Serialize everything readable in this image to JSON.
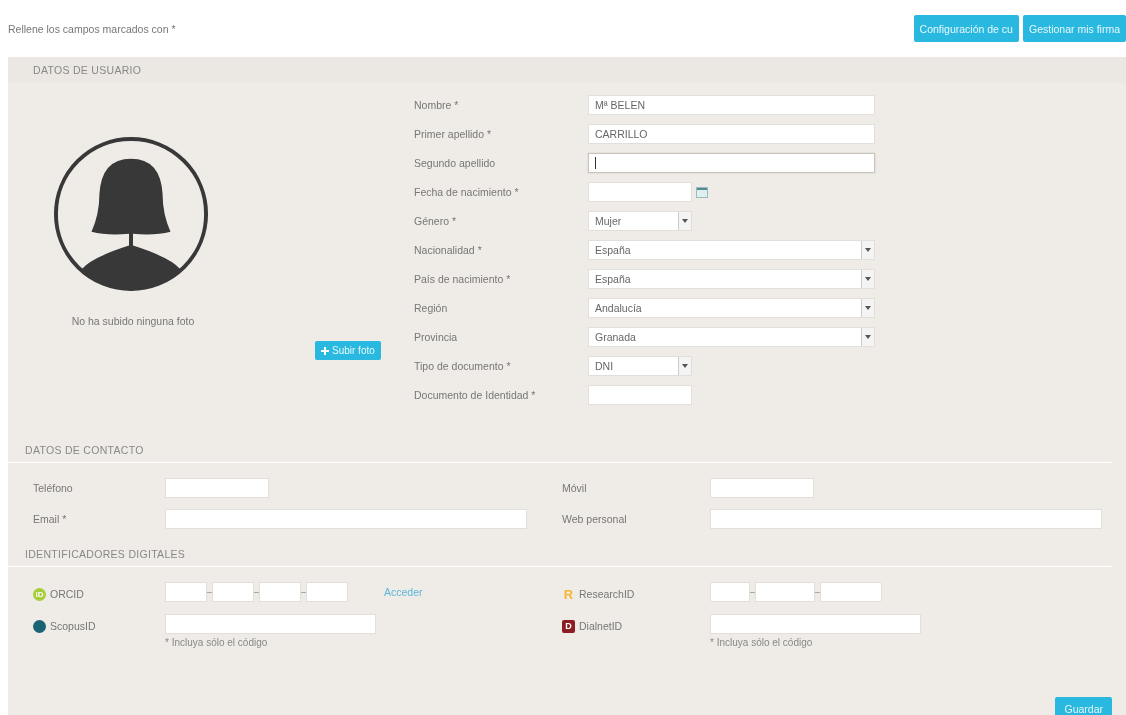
{
  "top": {
    "instruction": "Rellene los campos marcados con *",
    "buttons": [
      "Configuración de cu",
      "Gestionar mis firma"
    ]
  },
  "user": {
    "title": "DATOS DE USUARIO",
    "photo_caption": "No ha subido ninguna foto",
    "upload_button": "Subir foto",
    "fields": [
      {
        "label": "Nombre *",
        "kind": "text",
        "value": "Mª BELEN",
        "focused": false
      },
      {
        "label": "Primer apellido *",
        "kind": "text",
        "value": "CARRILLO",
        "focused": false
      },
      {
        "label": "Segundo apellido",
        "kind": "text",
        "focused": true
      },
      {
        "label": "Fecha de nacimiento *",
        "kind": "date",
        "focused": false
      },
      {
        "label": "Género *",
        "kind": "short_select",
        "value": "Mujer",
        "focused": false
      },
      {
        "label": "Nacionalidad *",
        "kind": "select",
        "value": "España",
        "focused": false
      },
      {
        "label": "País de nacimiento *",
        "kind": "select",
        "value": "España",
        "focused": false
      },
      {
        "label": "Región",
        "kind": "select",
        "value": "Andalucía",
        "focused": false
      },
      {
        "label": "Provincia",
        "kind": "select",
        "value": "Granada",
        "focused": false
      },
      {
        "label": "Tipo de documento *",
        "kind": "short_select",
        "value": "DNI",
        "focused": false
      },
      {
        "label": "Documento de Identidad *",
        "kind": "short_text",
        "focused": false
      }
    ]
  },
  "contact": {
    "title": "DATOS DE CONTACTO",
    "fields": [
      {
        "label": "Teléfono",
        "kind": "short_text"
      },
      {
        "label": "Móvil",
        "kind": "short_text"
      },
      {
        "label": "Email *",
        "kind": "text"
      },
      {
        "label": "Web personal",
        "kind": "text"
      }
    ]
  },
  "identifiers": {
    "title": "IDENTIFICADORES DIGITALES",
    "items": [
      {
        "label": "ORCID",
        "color": "#a6ce39",
        "badge": "iD",
        "kind": "four_part",
        "link": "Acceder"
      },
      {
        "label": "ResearchID",
        "color": "#f5b731",
        "badge": "R",
        "kind": "three_part"
      },
      {
        "label": "ScopusID",
        "color": "#1a6373",
        "kind": "code",
        "note": "* Incluya sólo el código"
      },
      {
        "label": "DialnetID",
        "color": "#8c1d22",
        "badge": "D",
        "kind": "code",
        "note": "* Incluya sólo el código"
      }
    ]
  },
  "save_button": "Guardar"
}
